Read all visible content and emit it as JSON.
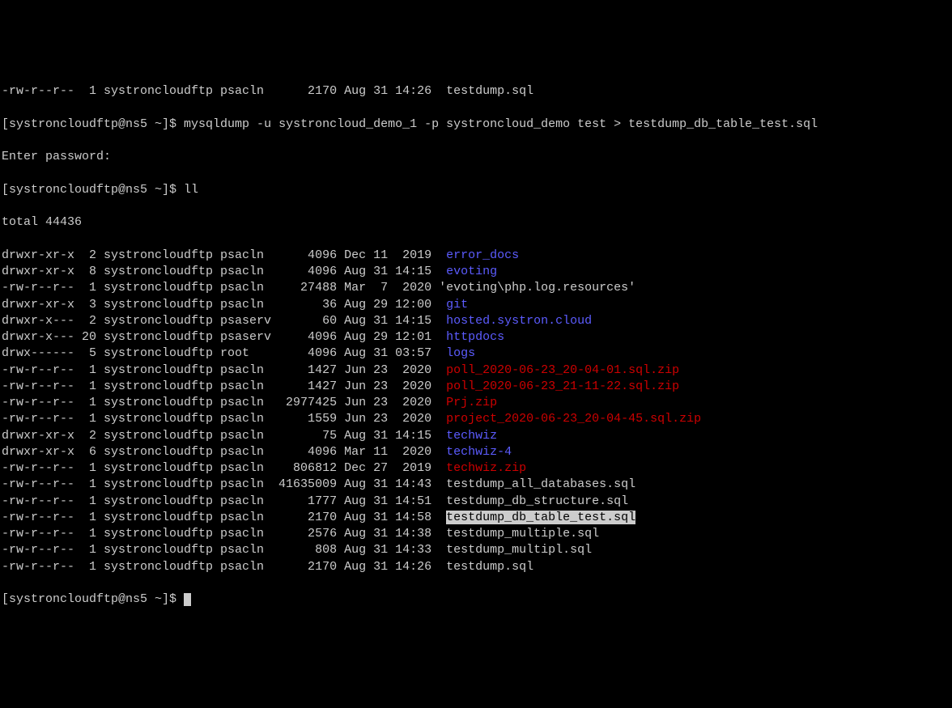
{
  "line0": "-rw-r--r--  1 systroncloudftp psacln      2170 Aug 31 14:26  testdump.sql",
  "prompt1": "[systroncloudftp@ns5 ~]$ ",
  "cmd1": "mysqldump -u systroncloud_demo_1 -p systroncloud_demo test > testdump_db_table_test.sql",
  "enter_password": "Enter password:",
  "prompt2": "[systroncloudftp@ns5 ~]$ ",
  "cmd2": "ll",
  "total_line": "total 44436",
  "rows": [
    {
      "meta": "drwxr-xr-x  2 systroncloudftp psacln      4096 Dec 11  2019  ",
      "name": "error_docs",
      "cls": "dir-color"
    },
    {
      "meta": "drwxr-xr-x  8 systroncloudftp psacln      4096 Aug 31 14:15  ",
      "name": "evoting",
      "cls": "dir-color"
    },
    {
      "meta": "-rw-r--r--  1 systroncloudftp psacln     27488 Mar  7  2020 ",
      "name": "'evoting\\php.log.resources'",
      "cls": "quoted-color"
    },
    {
      "meta": "drwxr-xr-x  3 systroncloudftp psacln        36 Aug 29 12:00  ",
      "name": "git",
      "cls": "dir-color"
    },
    {
      "meta": "drwxr-x---  2 systroncloudftp psaserv       60 Aug 31 14:15  ",
      "name": "hosted.systron.cloud",
      "cls": "dir-color"
    },
    {
      "meta": "drwxr-x--- 20 systroncloudftp psaserv     4096 Aug 29 12:01  ",
      "name": "httpdocs",
      "cls": "dir-color"
    },
    {
      "meta": "drwx------  5 systroncloudftp root        4096 Aug 31 03:57  ",
      "name": "logs",
      "cls": "dir-color"
    },
    {
      "meta": "-rw-r--r--  1 systroncloudftp psacln      1427 Jun 23  2020  ",
      "name": "poll_2020-06-23_20-04-01.sql.zip",
      "cls": "zip-color"
    },
    {
      "meta": "-rw-r--r--  1 systroncloudftp psacln      1427 Jun 23  2020  ",
      "name": "poll_2020-06-23_21-11-22.sql.zip",
      "cls": "zip-color"
    },
    {
      "meta": "-rw-r--r--  1 systroncloudftp psacln   2977425 Jun 23  2020  ",
      "name": "Prj.zip",
      "cls": "zip-color"
    },
    {
      "meta": "-rw-r--r--  1 systroncloudftp psacln      1559 Jun 23  2020  ",
      "name": "project_2020-06-23_20-04-45.sql.zip",
      "cls": "zip-color"
    },
    {
      "meta": "drwxr-xr-x  2 systroncloudftp psacln        75 Aug 31 14:15  ",
      "name": "techwiz",
      "cls": "dir-color"
    },
    {
      "meta": "drwxr-xr-x  6 systroncloudftp psacln      4096 Mar 11  2020  ",
      "name": "techwiz-4",
      "cls": "dir-color"
    },
    {
      "meta": "-rw-r--r--  1 systroncloudftp psacln    806812 Dec 27  2019  ",
      "name": "techwiz.zip",
      "cls": "zip-color"
    },
    {
      "meta": "-rw-r--r--  1 systroncloudftp psacln  41635009 Aug 31 14:43  ",
      "name": "testdump_all_databases.sql",
      "cls": ""
    },
    {
      "meta": "-rw-r--r--  1 systroncloudftp psacln      1777 Aug 31 14:51  ",
      "name": "testdump_db_structure.sql",
      "cls": ""
    },
    {
      "meta": "-rw-r--r--  1 systroncloudftp psacln      2170 Aug 31 14:58  ",
      "name": "testdump_db_table_test.sql",
      "cls": "highlight"
    },
    {
      "meta": "-rw-r--r--  1 systroncloudftp psacln      2576 Aug 31 14:38  ",
      "name": "testdump_multiple.sql",
      "cls": ""
    },
    {
      "meta": "-rw-r--r--  1 systroncloudftp psacln       808 Aug 31 14:33  ",
      "name": "testdump_multipl.sql",
      "cls": ""
    },
    {
      "meta": "-rw-r--r--  1 systroncloudftp psacln      2170 Aug 31 14:26  ",
      "name": "testdump.sql",
      "cls": ""
    }
  ],
  "prompt3": "[systroncloudftp@ns5 ~]$ "
}
